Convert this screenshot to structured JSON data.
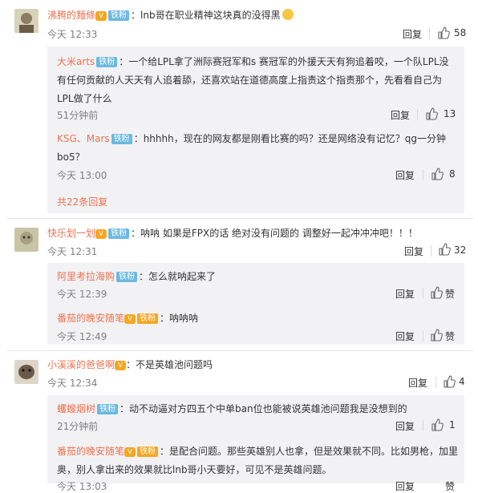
{
  "c1": {
    "name": "沸腾的麵條",
    "badge": "铁粉",
    "text": "：lnb哥在职业精神这块真的没得黑",
    "time": "今天 12:33",
    "reply": "回复",
    "likes": "58"
  },
  "r1": {
    "name": "大米arts",
    "badge": "铁粉",
    "line1": "：一个给LPL拿了洲际赛冠军和s 赛冠军的外援天天有狗追着咬，一个队LPL没",
    "line2": "有任何贡献的人天天有人追着舔，还喜欢站在道德高度上指责这个指责那个，先看看自己为",
    "line3": "LPL做了什么",
    "time": "51分钟前",
    "reply": "回复",
    "likes": "13"
  },
  "r2": {
    "name": "KSG、Mars",
    "badge": "铁粉",
    "line1": "：hhhhh，现在的网友都是刚看比赛的吗？还是网络没有记忆？qg一分钟",
    "line2": "bo5？",
    "time": "今天 13:00",
    "reply": "回复",
    "likes": "8"
  },
  "more1": "共22条回复",
  "c2": {
    "name": "快乐划一划",
    "badge": "铁粉",
    "text": "：呐呐 如果是FPX的话 绝对没有问题的 调整好一起冲冲冲吧！！！",
    "time": "今天 12:31",
    "reply": "回复",
    "likes": "32"
  },
  "r3": {
    "name": "阿里考拉海购",
    "badge": "铁粉",
    "text": "：怎么就呐起来了",
    "time": "今天 12:39",
    "reply": "回复",
    "likes": "赞"
  },
  "r4": {
    "name": "番茄的晚安随笔",
    "badge": "铁粉",
    "text": "：呐呐呐",
    "time": "今天 12:49",
    "reply": "回复",
    "likes": "赞"
  },
  "c3": {
    "name": "小溪溪的爸爸啊",
    "text": "：不是英雄池问题吗",
    "time": "今天 12:34",
    "reply": "回复",
    "likes": "4"
  },
  "r5": {
    "name": "蠼螋烟树",
    "badge": "铁粉",
    "text": "：动不动逼对方四五个中单ban位也能被说英雄池问题我是没想到的",
    "time": "21分钟前",
    "reply": "回复",
    "likes": "1"
  },
  "r6": {
    "name": "番茄的晚安随笔",
    "badge": "铁粉",
    "line1": "：是配合问题。那些英雄别人也拿，但是效果就不同。比如男枪，加里",
    "line2": "奥，别人拿出来的效果就比lnb哥小天要好，可见不是英雄问题。",
    "time": "今天 13:03",
    "reply": "回复",
    "likes": "赞"
  }
}
